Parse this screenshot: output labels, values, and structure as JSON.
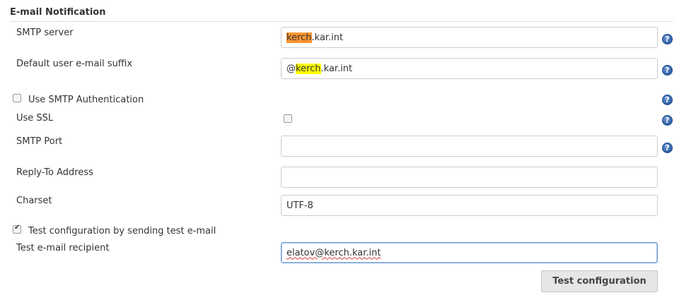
{
  "section": {
    "title": "E-mail Notification"
  },
  "smtp_server": {
    "label": "SMTP server",
    "value_highlight": "kerch",
    "value_rest": ".kar.int"
  },
  "email_suffix": {
    "label": "Default user e-mail suffix",
    "value_prefix": "@",
    "value_highlight": "kerch",
    "value_rest": ".kar.int"
  },
  "smtp_auth": {
    "label": "Use SMTP Authentication",
    "checked": false
  },
  "use_ssl": {
    "label": "Use SSL",
    "checked": false
  },
  "smtp_port": {
    "label": "SMTP Port",
    "value": ""
  },
  "reply_to": {
    "label": "Reply-To Address",
    "value": ""
  },
  "charset": {
    "label": "Charset",
    "value": "UTF-8"
  },
  "test_config": {
    "label": "Test configuration by sending test e-mail",
    "checked": true
  },
  "test_recipient": {
    "label": "Test e-mail recipient",
    "value": "elatov@kerch.kar.int"
  },
  "test_button": {
    "label": "Test configuration"
  },
  "help_icon": {
    "glyph": "?",
    "name": "help-icon",
    "color": "#2f5fa3"
  },
  "colors": {
    "highlight_current": "#ff9632",
    "highlight_other": "#ffff00",
    "focus_border": "#6f9ed3"
  }
}
